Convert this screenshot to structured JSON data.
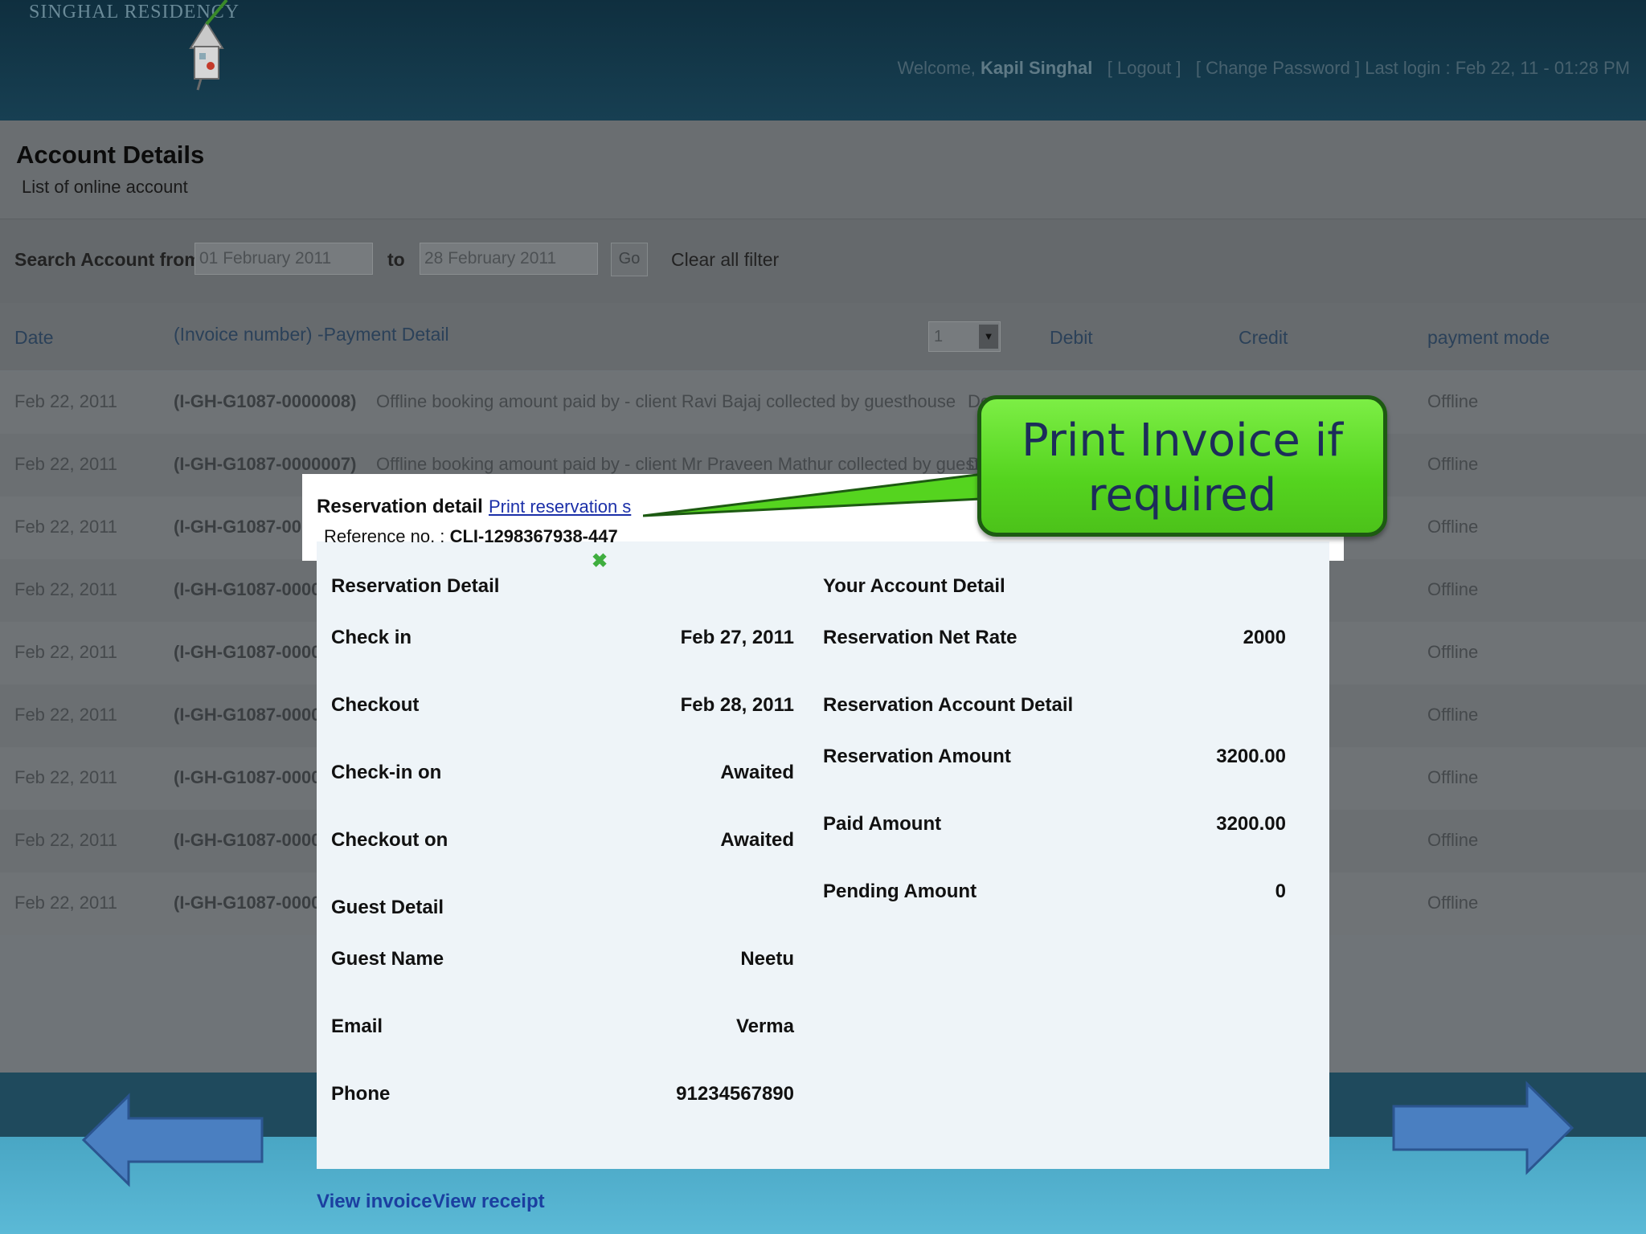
{
  "header": {
    "brand": "SINGHAL RESIDENCY",
    "welcome_prefix": "Welcome,",
    "user_name": "Kapil Singhal",
    "logout": "[ Logout ]",
    "change_password": "[ Change Password ]",
    "last_login": "Last login : Feb 22, 11 - 01:28 PM"
  },
  "account": {
    "title": "Account Details",
    "subtitle": "List of online account"
  },
  "search": {
    "label": "Search Account from",
    "from_value": "01 February 2011",
    "to_label": "to",
    "to_value": "28 February 2011",
    "go": "Go",
    "clear": "Clear all filter"
  },
  "table": {
    "headers": {
      "date": "Date",
      "detail": "(Invoice number) -Payment Detail",
      "page_select": "1",
      "debit": "Debit",
      "credit": "Credit",
      "mode": "payment mode"
    },
    "rows": [
      {
        "date": "Feb 22, 2011",
        "invoice": "(I-GH-G1087-0000008)",
        "detail": "Offline booking amount paid by - client Ravi Bajaj collected by guesthouse",
        "debit": "De",
        "mode": "Offline"
      },
      {
        "date": "Feb 22, 2011",
        "invoice": "(I-GH-G1087-0000007)",
        "detail": "Offline booking amount paid by - client Mr Praveen Mathur collected by guesthouse",
        "debit": "D",
        "mode": "Offline"
      },
      {
        "date": "Feb 22, 2011",
        "invoice": "(I-GH-G1087-00",
        "detail": "",
        "debit": "",
        "mode": "Offline"
      },
      {
        "date": "Feb 22, 2011",
        "invoice": "(I-GH-G1087-0000",
        "detail": "",
        "debit": "",
        "mode": "Offline"
      },
      {
        "date": "Feb 22, 2011",
        "invoice": "(I-GH-G1087-0000",
        "detail": "",
        "debit": "",
        "mode": "Offline"
      },
      {
        "date": "Feb 22, 2011",
        "invoice": "(I-GH-G1087-0000",
        "detail": "",
        "debit": "",
        "mode": "Offline"
      },
      {
        "date": "Feb 22, 2011",
        "invoice": "(I-GH-G1087-0000",
        "detail": "",
        "debit": "",
        "mode": "Offline"
      },
      {
        "date": "Feb 22, 2011",
        "invoice": "(I-GH-G1087-0000",
        "detail": "",
        "debit": "",
        "mode": "Offline"
      },
      {
        "date": "Feb 22, 2011",
        "invoice": "(I-GH-G1087-0000",
        "detail": "",
        "debit": "",
        "mode": "Offline"
      }
    ]
  },
  "modal": {
    "title": "Reservation detail",
    "print_link": "Print reservation s",
    "reference_label": "Reference no. :",
    "reference_value": "CLI-1298367938-447",
    "left_section": "Reservation Detail",
    "left": [
      {
        "label": "Check in",
        "value": "Feb 27, 2011"
      },
      {
        "label": "Checkout",
        "value": "Feb 28, 2011"
      },
      {
        "label": "Check-in on",
        "value": "Awaited"
      },
      {
        "label": "Checkout on",
        "value": "Awaited"
      }
    ],
    "guest_section": "Guest Detail",
    "guest": [
      {
        "label": "Guest Name",
        "value": "Neetu"
      },
      {
        "label": "Email",
        "value": "Verma"
      },
      {
        "label": "Phone",
        "value": "91234567890"
      }
    ],
    "right_section": "Your Account Detail",
    "net_rate_label": "Reservation Net Rate",
    "net_rate_value": "2000",
    "account_section": "Reservation Account Detail",
    "right": [
      {
        "label": "Reservation Amount",
        "value": "3200.00"
      },
      {
        "label": "Paid Amount",
        "value": "3200.00"
      },
      {
        "label": "Pending Amount",
        "value": "0"
      }
    ],
    "view_invoice": "View invoice",
    "view_receipt": "View receipt"
  },
  "callout": {
    "text_line1": "Print Invoice if",
    "text_line2": "required"
  },
  "colors": {
    "callout_green": "#5ad724",
    "arrow_blue": "#4a7fc1",
    "link_blue": "#1b3fa0"
  }
}
